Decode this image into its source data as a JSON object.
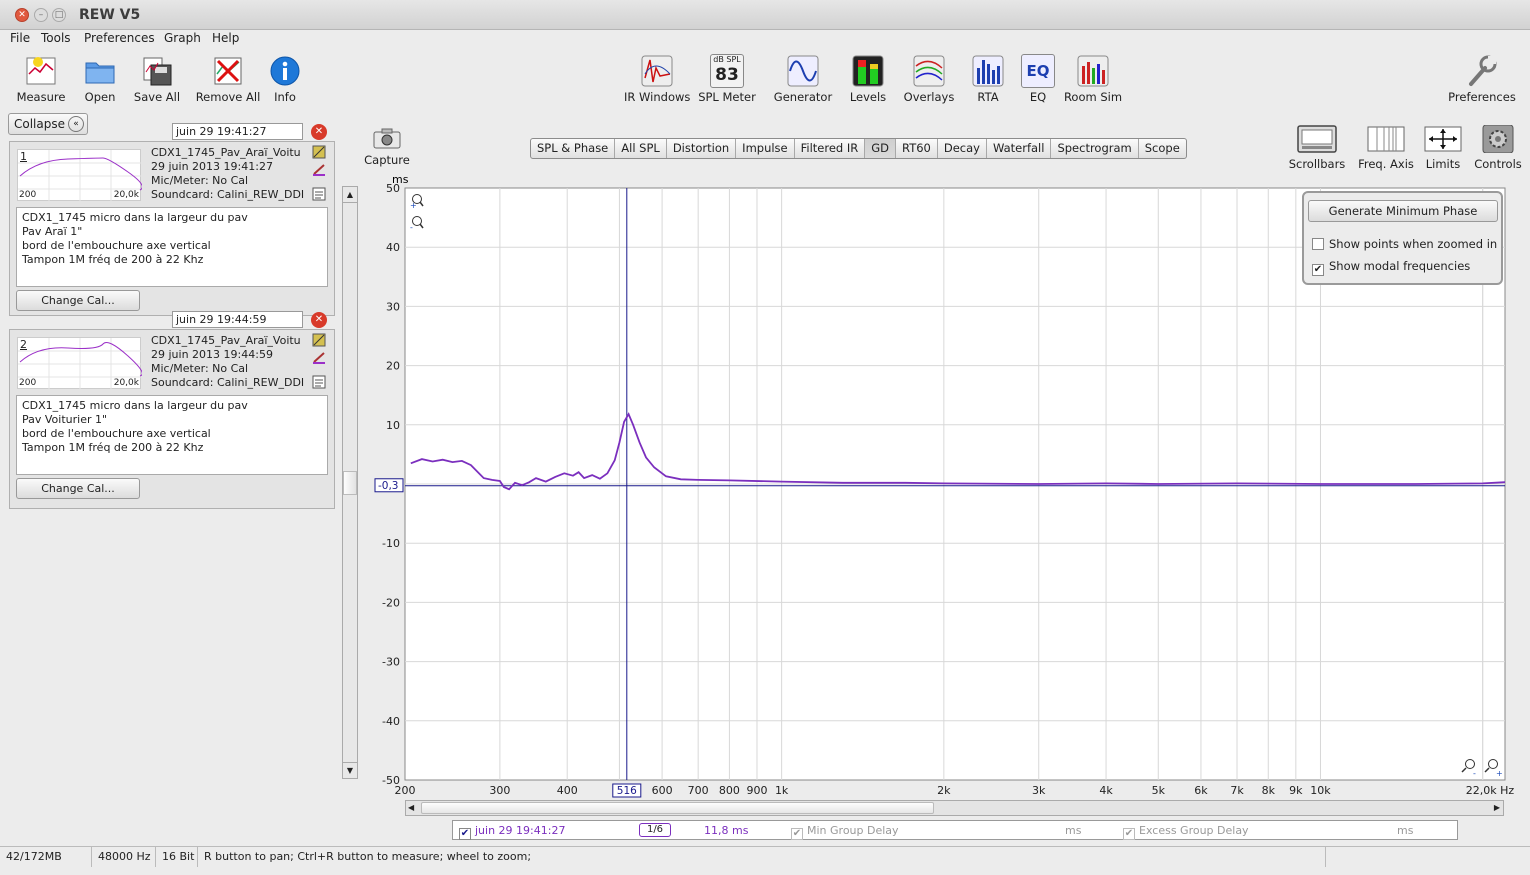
{
  "window": {
    "title": "REW V5"
  },
  "menu": [
    "File",
    "Tools",
    "Preferences",
    "Graph",
    "Help"
  ],
  "toolbar_left": [
    "Measure",
    "Open",
    "Save All",
    "Remove All",
    "Info"
  ],
  "toolbar_center": [
    "IR Windows",
    "SPL Meter",
    "Generator",
    "Levels",
    "Overlays",
    "RTA",
    "EQ",
    "Room Sim"
  ],
  "spl_meter": {
    "unit": "dB SPL",
    "value": "83"
  },
  "eq_icon_text": "EQ",
  "toolbar_right": "Preferences",
  "collapse_label": "Collapse",
  "measurements": [
    {
      "date_field": "juin 29 19:41:27",
      "number": "1",
      "range_lo": "200",
      "range_hi": "20,0k",
      "name": "CDX1_1745_Pav_Araï_Voitu",
      "datetime": "29 juin 2013 19:41:27",
      "mic": "Mic/Meter: No Cal",
      "soundcard": "Soundcard: Calini_REW_DDI",
      "notes": [
        "CDX1_1745 micro dans la largeur du pav",
        "Pav Araï 1\"",
        "bord de l'embouchure axe vertical",
        "Tampon 1M fréq de 200 à 22 Khz"
      ],
      "change_cal": "Change Cal..."
    },
    {
      "date_field": "juin 29 19:44:59",
      "number": "2",
      "range_lo": "200",
      "range_hi": "20,0k",
      "name": "CDX1_1745_Pav_Araï_Voitu",
      "datetime": "29 juin 2013 19:44:59",
      "mic": "Mic/Meter: No Cal",
      "soundcard": "Soundcard: Calini_REW_DDI",
      "notes": [
        "CDX1_1745 micro dans la largeur du pav",
        "Pav Voiturier 1\"",
        "bord de l'embouchure axe vertical",
        "Tampon 1M fréq de 200 à 22 Khz"
      ],
      "change_cal": "Change Cal..."
    }
  ],
  "capture_label": "Capture",
  "graph_tabs": [
    "SPL & Phase",
    "All SPL",
    "Distortion",
    "Impulse",
    "Filtered IR",
    "GD",
    "RT60",
    "Decay",
    "Waterfall",
    "Spectrogram",
    "Scope"
  ],
  "active_tab": "GD",
  "graph_tools": [
    "Scrollbars",
    "Freq. Axis",
    "Limits",
    "Controls"
  ],
  "controls_panel": {
    "button": "Generate Minimum Phase",
    "checkboxes": [
      {
        "label": "Show points when zoomed in",
        "checked": false
      },
      {
        "label": "Show modal frequencies",
        "checked": true
      }
    ]
  },
  "cursor": {
    "y_readout": "-0,3",
    "x_readout": "516"
  },
  "legend": {
    "measurement": "juin 29 19:41:27",
    "smoothing": "1/6",
    "value": "11,8 ms",
    "min_gd_label": "Min Group Delay",
    "min_gd_unit": "ms",
    "excess_gd_label": "Excess Group Delay",
    "excess_gd_unit": "ms"
  },
  "status": {
    "memory": "42/172MB",
    "rate": "48000 Hz",
    "bits": "16 Bit",
    "hint": "R button to pan; Ctrl+R button to measure; wheel to zoom;"
  },
  "colors": {
    "trace": "#7b2fbe",
    "cursor": "#1a1a8c",
    "grid": "#d8d8d8"
  },
  "chart_data": {
    "type": "line",
    "title": "",
    "xlabel": "Hz",
    "ylabel": "ms",
    "x_scale": "log",
    "xlim": [
      200,
      22000
    ],
    "ylim": [
      -50,
      50
    ],
    "grid": true,
    "x_ticks": [
      {
        "v": 200,
        "label": "200"
      },
      {
        "v": 300,
        "label": "300"
      },
      {
        "v": 400,
        "label": "400"
      },
      {
        "v": 600,
        "label": "600"
      },
      {
        "v": 700,
        "label": "700"
      },
      {
        "v": 800,
        "label": "800"
      },
      {
        "v": 900,
        "label": "900"
      },
      {
        "v": 1000,
        "label": "1k"
      },
      {
        "v": 2000,
        "label": "2k"
      },
      {
        "v": 3000,
        "label": "3k"
      },
      {
        "v": 4000,
        "label": "4k"
      },
      {
        "v": 5000,
        "label": "5k"
      },
      {
        "v": 6000,
        "label": "6k"
      },
      {
        "v": 7000,
        "label": "7k"
      },
      {
        "v": 8000,
        "label": "8k"
      },
      {
        "v": 9000,
        "label": "9k"
      },
      {
        "v": 10000,
        "label": "10k"
      },
      {
        "v": 22000,
        "label": "22,0k Hz"
      }
    ],
    "y_ticks": [
      50,
      40,
      30,
      20,
      10,
      -10,
      -20,
      -30,
      -40,
      -50
    ],
    "cursor_x": 516,
    "cursor_y": -0.3,
    "series": [
      {
        "x": [
          205,
          215,
          225,
          235,
          245,
          255,
          265,
          280,
          290,
          300,
          305,
          312,
          320,
          330,
          340,
          350,
          365,
          380,
          395,
          410,
          420,
          430,
          445,
          460,
          475,
          490,
          500,
          510,
          520,
          530,
          545,
          560,
          580,
          610,
          650,
          700,
          800,
          1000,
          1300,
          1700,
          2000,
          3000,
          4000,
          5000,
          7000,
          10000,
          15000,
          20000,
          22000
        ],
        "y": [
          3.5,
          4.2,
          3.8,
          4.1,
          3.7,
          3.9,
          3.2,
          1.0,
          0.7,
          0.5,
          -0.5,
          -0.9,
          0.2,
          -0.2,
          0.3,
          1.0,
          0.4,
          1.2,
          1.8,
          1.4,
          2.0,
          1.0,
          1.5,
          0.9,
          1.8,
          4.0,
          7.0,
          10.5,
          11.8,
          10.0,
          7.0,
          4.5,
          2.8,
          1.3,
          0.8,
          0.7,
          0.6,
          0.4,
          0.2,
          0.2,
          0.1,
          0.0,
          0.1,
          0.0,
          0.1,
          0.0,
          0.0,
          0.1,
          0.3
        ]
      }
    ]
  }
}
